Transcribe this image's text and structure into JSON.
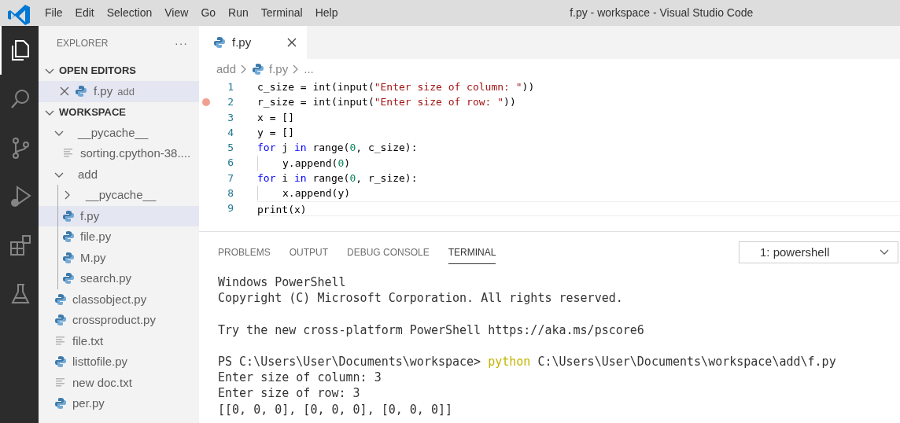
{
  "menu": [
    "File",
    "Edit",
    "Selection",
    "View",
    "Go",
    "Run",
    "Terminal",
    "Help"
  ],
  "window": {
    "title": "f.py - workspace - Visual Studio Code"
  },
  "activity_bar": [
    {
      "kind": "files",
      "selected": true
    },
    {
      "kind": "search",
      "selected": false
    },
    {
      "kind": "source-control",
      "selected": false
    },
    {
      "kind": "run",
      "selected": false
    },
    {
      "kind": "extensions",
      "selected": false
    },
    {
      "kind": "testing",
      "selected": false
    }
  ],
  "sidebar": {
    "title": "EXPLORER",
    "more": "···",
    "open_editors": {
      "label": "OPEN EDITORS",
      "expanded": true,
      "items": [
        {
          "name": "f.py",
          "description": "add",
          "kind": "python",
          "selected": true
        }
      ]
    },
    "workspace": {
      "label": "WORKSPACE",
      "expanded": true,
      "children": [
        {
          "name": "__pycache__",
          "kind": "folder",
          "expanded": true,
          "selected": false,
          "children": [
            {
              "name": "sorting.cpython-38....",
              "kind": "text",
              "selected": false
            }
          ]
        },
        {
          "name": "add",
          "kind": "folder",
          "expanded": true,
          "selected": false,
          "children": [
            {
              "name": "__pycache__",
              "kind": "folder",
              "expanded": false,
              "selected": false
            },
            {
              "name": "f.py",
              "kind": "python",
              "selected": true
            },
            {
              "name": "file.py",
              "kind": "python",
              "selected": false
            },
            {
              "name": "M.py",
              "kind": "python",
              "selected": false
            },
            {
              "name": "search.py",
              "kind": "python",
              "selected": false
            }
          ]
        },
        {
          "name": "classobject.py",
          "kind": "python",
          "selected": false
        },
        {
          "name": "crossproduct.py",
          "kind": "python",
          "selected": false
        },
        {
          "name": "file.txt",
          "kind": "text",
          "selected": false
        },
        {
          "name": "listtofile.py",
          "kind": "python",
          "selected": false
        },
        {
          "name": "new doc.txt",
          "kind": "text",
          "selected": false
        },
        {
          "name": "per.py",
          "kind": "python",
          "selected": false
        }
      ]
    }
  },
  "tabs": [
    {
      "label": "f.py",
      "kind": "python",
      "selected": true
    }
  ],
  "breadcrumb": [
    {
      "text": "add",
      "kind": "folder"
    },
    {
      "text": "f.py",
      "kind": "python"
    },
    {
      "text": "...",
      "kind": "more"
    }
  ],
  "code": [
    {
      "number": "1",
      "breakpoint": false,
      "indent_guide": false,
      "current": false,
      "tokens": [
        {
          "text": "c_size = int(input(",
          "kind": "plain"
        },
        {
          "text": "\"Enter size of column: \"",
          "kind": "string"
        },
        {
          "text": "))",
          "kind": "plain"
        }
      ]
    },
    {
      "number": "2",
      "breakpoint": true,
      "indent_guide": false,
      "current": false,
      "tokens": [
        {
          "text": "r_size = int(input(",
          "kind": "plain"
        },
        {
          "text": "\"Enter size of row: \"",
          "kind": "string"
        },
        {
          "text": "))",
          "kind": "plain"
        }
      ]
    },
    {
      "number": "3",
      "breakpoint": false,
      "indent_guide": false,
      "current": false,
      "tokens": [
        {
          "text": "x = []",
          "kind": "plain"
        }
      ]
    },
    {
      "number": "4",
      "breakpoint": false,
      "indent_guide": false,
      "current": false,
      "tokens": [
        {
          "text": "y = []",
          "kind": "plain"
        }
      ]
    },
    {
      "number": "5",
      "breakpoint": false,
      "indent_guide": false,
      "current": false,
      "tokens": [
        {
          "text": "for",
          "kind": "keyword"
        },
        {
          "text": " j ",
          "kind": "plain"
        },
        {
          "text": "in",
          "kind": "keyword"
        },
        {
          "text": " range(",
          "kind": "plain"
        },
        {
          "text": "0",
          "kind": "number"
        },
        {
          "text": ", c_size):",
          "kind": "plain"
        }
      ]
    },
    {
      "number": "6",
      "breakpoint": false,
      "indent_guide": true,
      "current": false,
      "tokens": [
        {
          "text": "y.append(",
          "kind": "plain"
        },
        {
          "text": "0",
          "kind": "number"
        },
        {
          "text": ")",
          "kind": "plain"
        }
      ]
    },
    {
      "number": "7",
      "breakpoint": false,
      "indent_guide": false,
      "current": false,
      "tokens": [
        {
          "text": "for",
          "kind": "keyword"
        },
        {
          "text": " i ",
          "kind": "plain"
        },
        {
          "text": "in",
          "kind": "keyword"
        },
        {
          "text": " range(",
          "kind": "plain"
        },
        {
          "text": "0",
          "kind": "number"
        },
        {
          "text": ", r_size):",
          "kind": "plain"
        }
      ]
    },
    {
      "number": "8",
      "breakpoint": false,
      "indent_guide": true,
      "current": false,
      "tokens": [
        {
          "text": "x.append(y)",
          "kind": "plain"
        }
      ]
    },
    {
      "number": "9",
      "breakpoint": false,
      "indent_guide": false,
      "current": true,
      "tokens": [
        {
          "text": "print(x)",
          "kind": "plain"
        }
      ]
    }
  ],
  "panel": {
    "tabs": [
      {
        "label": "PROBLEMS",
        "selected": false
      },
      {
        "label": "OUTPUT",
        "selected": false
      },
      {
        "label": "DEBUG CONSOLE",
        "selected": false
      },
      {
        "label": "TERMINAL",
        "selected": true
      }
    ],
    "terminal_select": "1: powershell",
    "terminal": [
      {
        "gap_before": false,
        "tokens": [
          {
            "text": "Windows PowerShell",
            "kind": "plain"
          }
        ]
      },
      {
        "gap_before": false,
        "tokens": [
          {
            "text": "Copyright (C) Microsoft Corporation. All rights reserved.",
            "kind": "plain"
          }
        ]
      },
      {
        "gap_before": true,
        "tokens": [
          {
            "text": "Try the new cross-platform PowerShell https://aka.ms/pscore6",
            "kind": "plain"
          }
        ]
      },
      {
        "gap_before": true,
        "tokens": [
          {
            "text": "PS C:\\Users\\User\\Documents\\workspace> ",
            "kind": "plain"
          },
          {
            "text": "python",
            "kind": "command"
          },
          {
            "text": " C:\\Users\\User\\Documents\\workspace\\add\\f.py",
            "kind": "plain"
          }
        ]
      },
      {
        "gap_before": false,
        "tokens": [
          {
            "text": "Enter size of column: 3",
            "kind": "plain"
          }
        ]
      },
      {
        "gap_before": false,
        "tokens": [
          {
            "text": "Enter size of row: 3",
            "kind": "plain"
          }
        ]
      },
      {
        "gap_before": false,
        "tokens": [
          {
            "text": "[[0, 0, 0], [0, 0, 0], [0, 0, 0]]",
            "kind": "plain"
          }
        ]
      }
    ]
  }
}
